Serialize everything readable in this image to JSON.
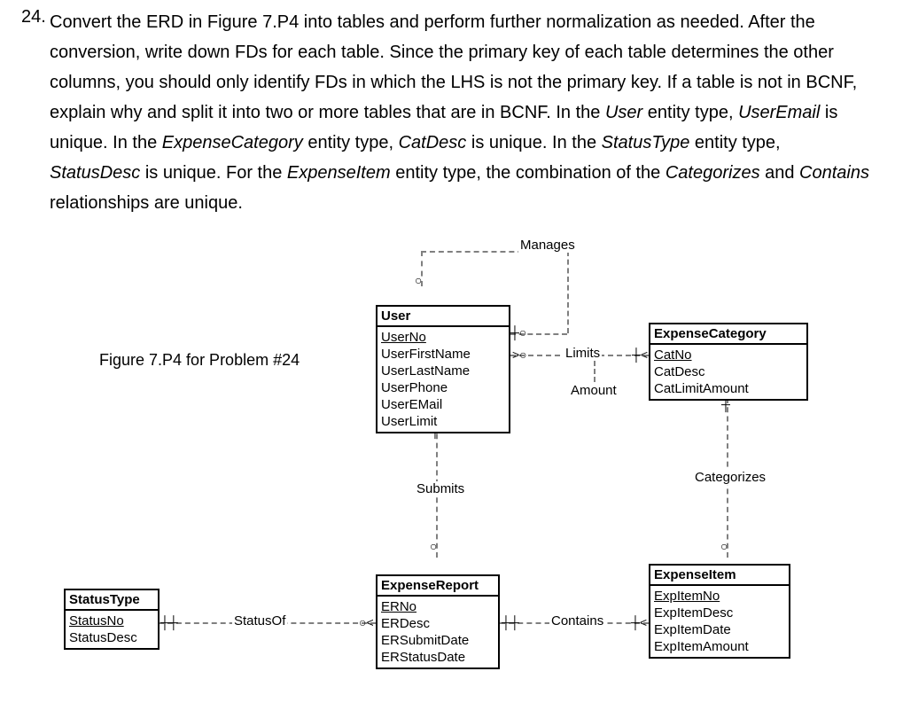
{
  "question_number": "24.",
  "question_text_parts": {
    "p1a": "Convert the ERD in Figure 7.P4 into tables and perform further normalization as needed. After the conversion, write down FDs for each table.  Since the primary key of each table determines the other columns, you should only identify FDs in which the LHS is not the primary key. If a table is not in BCNF, explain why and split it into two or more tables that are in BCNF. In the ",
    "user": "User",
    "p1b": " entity type, ",
    "useremail": "UserEmail",
    "p1c": " is unique. In the ",
    "expcat": "ExpenseCategory",
    "p1d": " entity type, ",
    "catdesc": "CatDesc",
    "p1e": " is unique. In the ",
    "statustype": "StatusType",
    "p1f": " entity type, ",
    "statusdesc": "StatusDesc",
    "p1g": " is unique. For the ",
    "expitem": "ExpenseItem",
    "p1h": " entity type, the combination of the ",
    "categorizes": "Categorizes",
    "p1i": " and ",
    "contains": "Contains",
    "p1j": " relationships are unique."
  },
  "figure_caption": "Figure 7.P4 for Problem #24",
  "relationships": {
    "manages": "Manages",
    "limits": "Limits",
    "limits_attr": "Amount",
    "submits": "Submits",
    "categorizes": "Categorizes",
    "contains": "Contains",
    "statusof": "StatusOf"
  },
  "entities": {
    "user": {
      "title": "User",
      "pk": "UserNo",
      "attrs": [
        "UserFirstName",
        "UserLastName",
        "UserPhone",
        "UserEMail",
        "UserLimit"
      ]
    },
    "expense_category": {
      "title": "ExpenseCategory",
      "pk": "CatNo",
      "attrs": [
        "CatDesc",
        "CatLimitAmount"
      ]
    },
    "status_type": {
      "title": "StatusType",
      "pk": "StatusNo",
      "attrs": [
        "StatusDesc"
      ]
    },
    "expense_report": {
      "title": "ExpenseReport",
      "pk": "ERNo",
      "attrs": [
        "ERDesc",
        "ERSubmitDate",
        "ERStatusDate"
      ]
    },
    "expense_item": {
      "title": "ExpenseItem",
      "pk": "ExpItemNo",
      "attrs": [
        "ExpItemDesc",
        "ExpItemDate",
        "ExpItemAmount"
      ]
    }
  }
}
